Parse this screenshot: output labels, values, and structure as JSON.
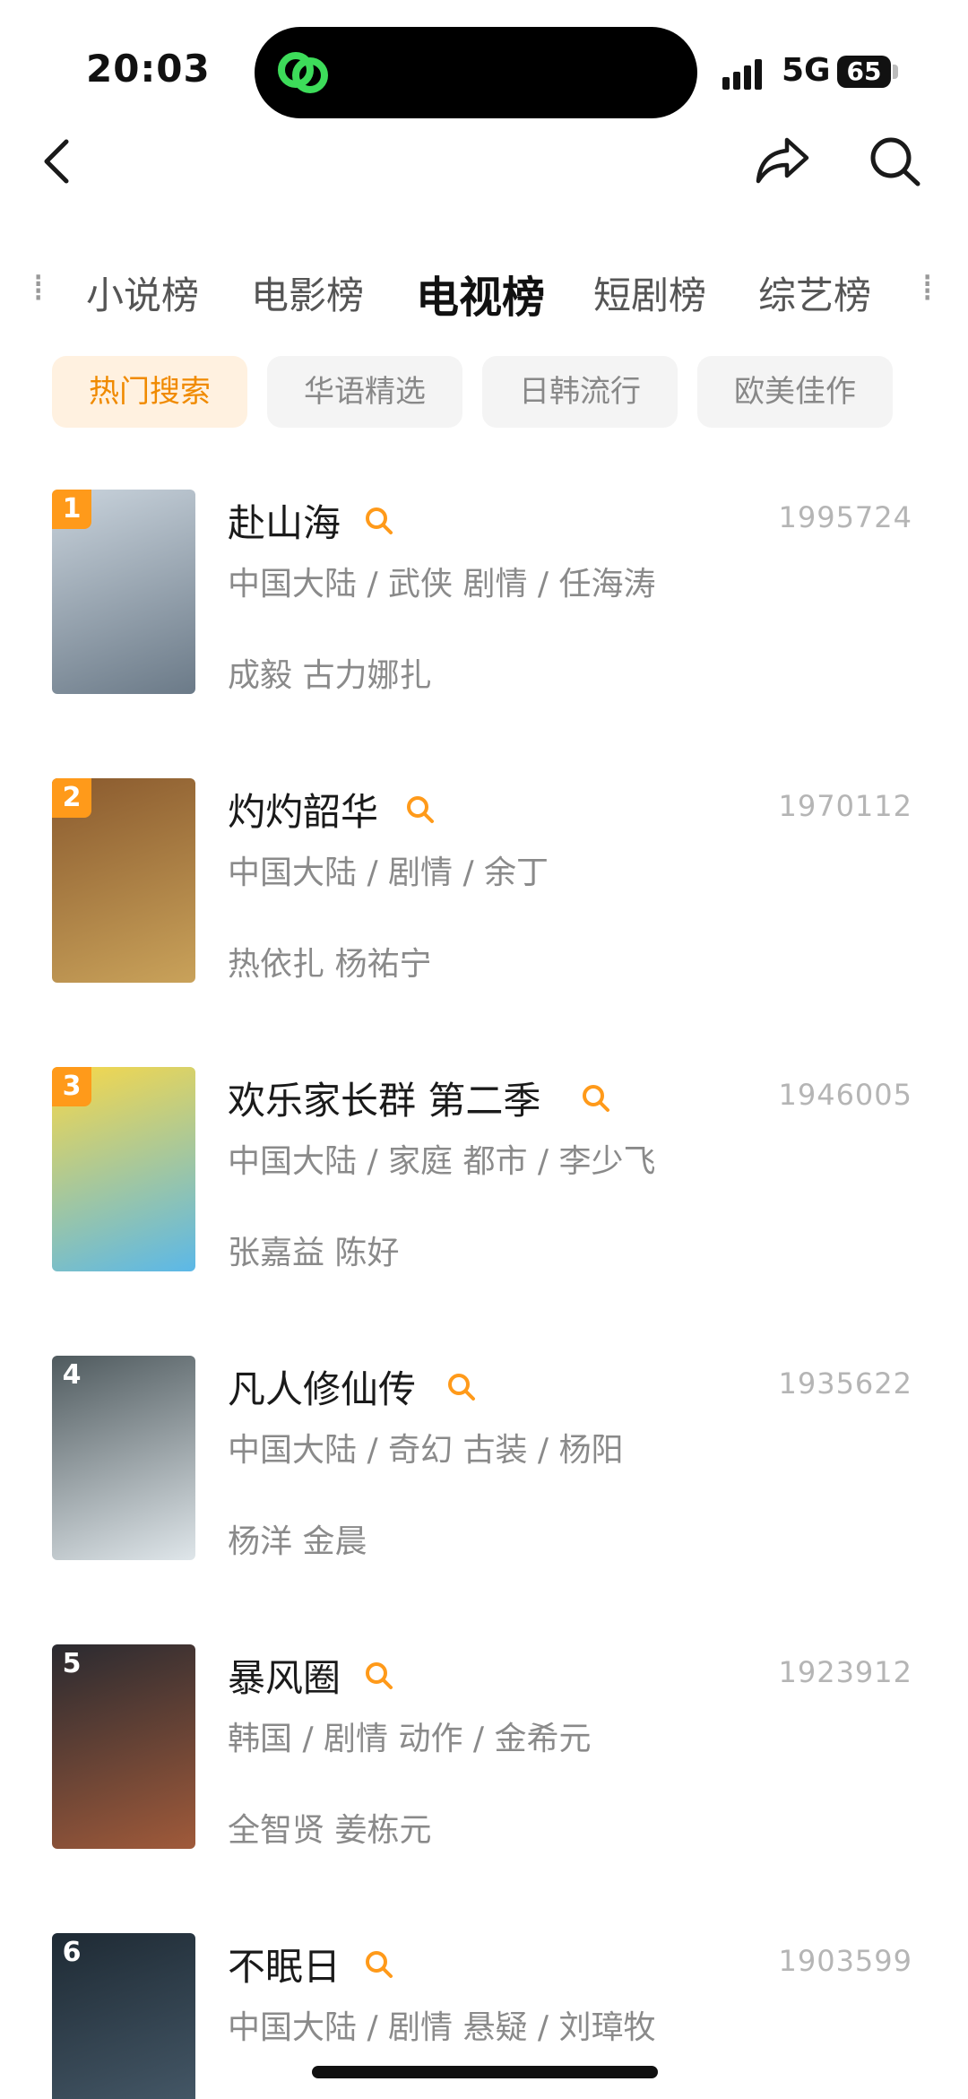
{
  "status_bar": {
    "time": "20:03",
    "network": "5G",
    "battery": "65"
  },
  "nav": {
    "back_icon": "chevron-left-icon",
    "share_icon": "share-arrow-icon",
    "search_icon": "search-icon"
  },
  "category_tabs": [
    {
      "label": "小说榜",
      "active": false
    },
    {
      "label": "电影榜",
      "active": false
    },
    {
      "label": "电视榜",
      "active": true
    },
    {
      "label": "短剧榜",
      "active": false
    },
    {
      "label": "综艺榜",
      "active": false
    }
  ],
  "filter_chips": [
    {
      "label": "热门搜索",
      "active": true
    },
    {
      "label": "华语精选",
      "active": false
    },
    {
      "label": "日韩流行",
      "active": false
    },
    {
      "label": "欧美佳作",
      "active": false
    }
  ],
  "colors": {
    "accent": "#ff9a1a",
    "accent_text": "#f08a00",
    "chip_active_bg": "#fff1e0"
  },
  "ranking": [
    {
      "rank": "1",
      "title": "赴山海",
      "count": "1995724",
      "meta": "中国大陆 / 武侠 剧情 / 任海涛",
      "cast": "成毅 古力娜扎",
      "poster_colors": [
        "#c9d3dc",
        "#6b7a88"
      ]
    },
    {
      "rank": "2",
      "title": "灼灼韶华",
      "count": "1970112",
      "meta": "中国大陆 / 剧情 / 余丁",
      "cast": "热依扎 杨祐宁",
      "poster_colors": [
        "#8a5a2e",
        "#c9a25a"
      ]
    },
    {
      "rank": "3",
      "title": "欢乐家长群 第二季",
      "count": "1946005",
      "meta": "中国大陆 / 家庭 都市 / 李少飞",
      "cast": "张嘉益 陈好",
      "poster_colors": [
        "#f7d84a",
        "#5bb8e8"
      ]
    },
    {
      "rank": "4",
      "title": "凡人修仙传",
      "count": "1935622",
      "meta": "中国大陆 / 奇幻 古装 / 杨阳",
      "cast": "杨洋 金晨",
      "poster_colors": [
        "#4f5a5e",
        "#dfe6ea"
      ]
    },
    {
      "rank": "5",
      "title": "暴风圈",
      "count": "1923912",
      "meta": "韩国 / 剧情 动作 / 金希元",
      "cast": "全智贤 姜栋元",
      "poster_colors": [
        "#2a2a30",
        "#a05a3a"
      ]
    },
    {
      "rank": "6",
      "title": "不眠日",
      "count": "1903599",
      "meta": "中国大陆 / 剧情 悬疑 / 刘璋牧",
      "cast": "",
      "poster_colors": [
        "#1e2a34",
        "#4a5e6e"
      ]
    }
  ]
}
